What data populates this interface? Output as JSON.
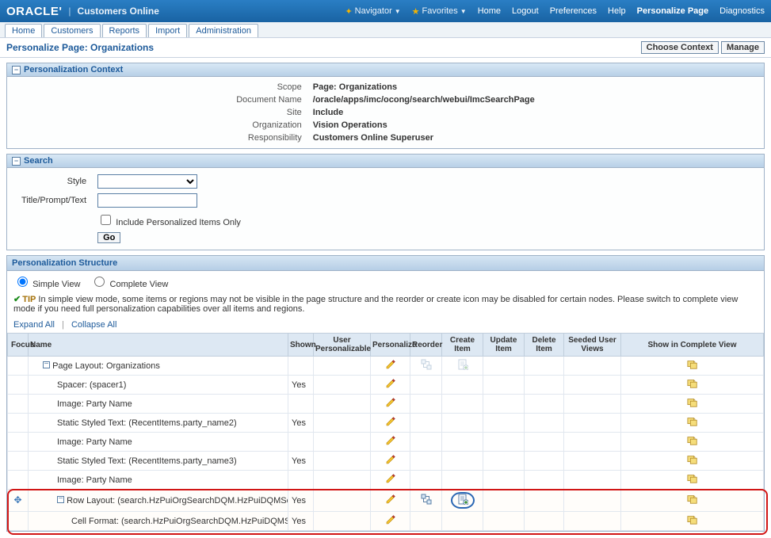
{
  "brand": {
    "oracle": "ORACLE'",
    "app": "Customers Online"
  },
  "topnav": {
    "navigator": "Navigator",
    "favorites": "Favorites",
    "links": {
      "home": "Home",
      "logout": "Logout",
      "preferences": "Preferences",
      "help": "Help",
      "personalize": "Personalize Page",
      "diagnostics": "Diagnostics"
    }
  },
  "tabs": [
    {
      "label": "Home"
    },
    {
      "label": "Customers"
    },
    {
      "label": "Reports"
    },
    {
      "label": "Import"
    },
    {
      "label": "Administration"
    }
  ],
  "page": {
    "subtitle": "Personalize Page: Organizations",
    "buttons": {
      "choose_context": "Choose Context",
      "manage": "Manage"
    }
  },
  "context": {
    "title": "Personalization Context",
    "rows": [
      {
        "label": "Scope",
        "value": "Page: Organizations"
      },
      {
        "label": "Document Name",
        "value": "/oracle/apps/imc/ocong/search/webui/ImcSearchPage"
      },
      {
        "label": "Site",
        "value": "Include"
      },
      {
        "label": "Organization",
        "value": "Vision Operations"
      },
      {
        "label": "Responsibility",
        "value": "Customers Online Superuser"
      }
    ]
  },
  "search": {
    "title": "Search",
    "style_label": "Style",
    "title_label": "Title/Prompt/Text",
    "include_label": "Include Personalized Items Only",
    "go": "Go"
  },
  "structure": {
    "title": "Personalization Structure",
    "views": {
      "simple": "Simple View",
      "complete": "Complete View"
    },
    "tip_label": "TIP",
    "tip_text": "In simple view mode, some items or regions may not be visible in the page structure and the reorder or create icon may be disabled for certain nodes. Please switch to complete view mode if you need full personalization capabilities over all items and regions.",
    "expand": "Expand All",
    "collapse": "Collapse All",
    "columns": {
      "focus": "Focus",
      "name": "Name",
      "shown": "Shown",
      "userpers": "User Personalizable",
      "personalize": "Personalize",
      "reorder": "Reorder",
      "createitem": "Create Item",
      "updateitem": "Update Item",
      "deleteitem": "Delete Item",
      "seeded": "Seeded User Views",
      "showcomplete": "Show in Complete View"
    },
    "rows": [
      {
        "indent": 0,
        "expander": true,
        "name": "Page Layout: Organizations",
        "shown": "",
        "personalize": true,
        "reorder": "disabled",
        "create": "disabled",
        "complete": true
      },
      {
        "indent": 1,
        "name": "Spacer: (spacer1)",
        "shown": "Yes",
        "personalize": true,
        "complete": true
      },
      {
        "indent": 1,
        "name": "Image: Party Name",
        "shown": "",
        "personalize": true,
        "complete": true
      },
      {
        "indent": 1,
        "name": "Static Styled Text: (RecentItems.party_name2)",
        "shown": "Yes",
        "personalize": true,
        "complete": true
      },
      {
        "indent": 1,
        "name": "Image: Party Name",
        "shown": "",
        "personalize": true,
        "complete": true
      },
      {
        "indent": 1,
        "name": "Static Styled Text: (RecentItems.party_name3)",
        "shown": "Yes",
        "personalize": true,
        "complete": true
      },
      {
        "indent": 1,
        "name": "Image: Party Name",
        "shown": "",
        "personalize": true,
        "complete": true
      },
      {
        "indent": 1,
        "expander": true,
        "focus": true,
        "name": "Row Layout: (search.HzPuiOrgSearchDQM.HzPuiDQMSearchResults.SpacerRow)",
        "shown": "Yes",
        "personalize": true,
        "reorder": "active",
        "create": "active-circled",
        "complete": true,
        "highlight": true
      },
      {
        "indent": 2,
        "name": "Cell Format: (search.HzPuiOrgSearchDQM.HzPuiDQMSearchResults.FndCellFormat)",
        "shown": "Yes",
        "personalize": true,
        "complete": true,
        "highlight": true
      }
    ]
  }
}
